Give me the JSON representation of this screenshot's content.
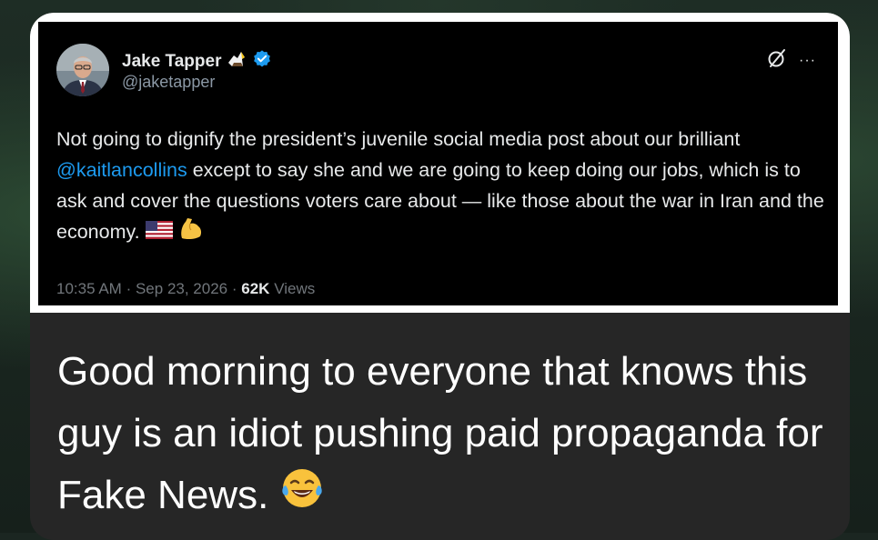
{
  "tweet": {
    "display_name": "Jake Tapper",
    "handle": "@jaketapper",
    "text_part1": "Not going to dignify the president’s juvenile social media post about our brilliant ",
    "mention": "@kaitlancollins",
    "text_part2": " except to say she and we are going to keep doing our jobs, which is to ask and cover the questions voters care about — like those about the war in Iran and the economy.",
    "time": "10:35 AM",
    "date": "Sep 23, 2026",
    "views_count": "62K",
    "views_label": "Views",
    "separator": "·",
    "more_label": "···",
    "icons": [
      "eagle-emoji-icon",
      "verified-badge-icon",
      "grok-slash-icon",
      "more-icon",
      "us-flag-emoji-icon",
      "flexed-bicep-emoji-icon"
    ]
  },
  "caption": {
    "text": "Good morning to everyone that knows this guy is an idiot pushing paid propaganda for Fake News.",
    "emoji": "laughing-tears-emoji-icon"
  },
  "colors": {
    "tweet_bg": "#000000",
    "mention_blue": "#1d9bf0",
    "verified_blue": "#1d9bf0",
    "meta_gray": "#71767b",
    "card_bg": "#262626"
  }
}
